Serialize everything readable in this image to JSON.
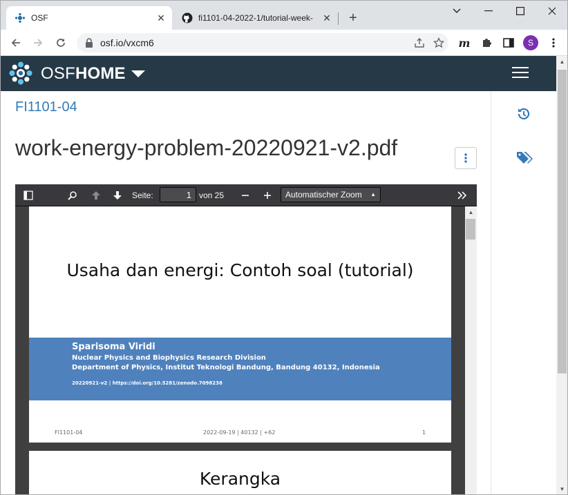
{
  "browser": {
    "tabs": [
      {
        "title": "OSF",
        "favicon": "osf-logo-icon",
        "active": true
      },
      {
        "title": "fi1101-04-2022-1/tutorial-week-",
        "favicon": "github-icon",
        "active": false
      }
    ],
    "url": "osf.io/vxcm6",
    "profile_initial": "S",
    "profile_color": "#7b2fb3"
  },
  "osf": {
    "brand_light": "OSF",
    "brand_bold": "HOME",
    "nav_color": "#263947"
  },
  "page": {
    "project_name": "FI1101-04",
    "file_name": "work-energy-problem-20220921-v2.pdf",
    "link_color": "#337ab7"
  },
  "pdf_viewer": {
    "page_label": "Seite:",
    "page_value": "1",
    "page_count_label": "von 25",
    "zoom_value": "Automatischer Zoom"
  },
  "pdf_pages": {
    "page1": {
      "title": "Usaha dan energi: Contoh soal (tutorial)",
      "author": "Sparisoma Viridi",
      "division": "Nuclear Physics and Biophysics Research Division",
      "department": "Department of Physics, Institut Teknologi Bandung, Bandung 40132, Indonesia",
      "doi_line": "20220921-v2 | https://doi.org/10.5281/zenodo.7098238",
      "footer_left": "FI1101-04",
      "footer_center": "2022-09-19 | 40132 | +62",
      "footer_right": "1",
      "banner_color": "#4f81bd"
    },
    "page2": {
      "title": "Kerangka"
    }
  }
}
